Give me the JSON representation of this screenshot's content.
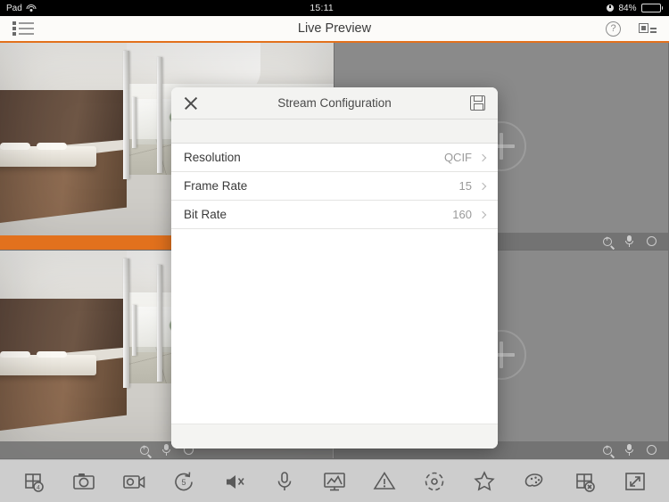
{
  "status_bar": {
    "carrier": "Pad",
    "wifi_icon": "wifi-icon",
    "time": "15:11",
    "lock_icon": "rotation-lock-icon",
    "battery_percent": "84%",
    "battery_level": 84
  },
  "nav_bar": {
    "menu_icon": "list-menu-icon",
    "title": "Live Preview",
    "help_icon": "help-circle-icon",
    "device_icon": "device-list-icon",
    "accent_color": "#e2711d"
  },
  "grid": {
    "tiles": [
      {
        "id": "tile-1",
        "state": "live",
        "selected": true,
        "overlay_icons": [
          "zoom-in-icon",
          "microphone-icon",
          "record-circle-icon"
        ]
      },
      {
        "id": "tile-2",
        "state": "empty",
        "selected": false,
        "add_label": "+"
      },
      {
        "id": "tile-3",
        "state": "live",
        "selected": false,
        "overlay_icons": [
          "zoom-in-icon",
          "microphone-icon",
          "record-circle-icon"
        ]
      },
      {
        "id": "tile-4",
        "state": "empty",
        "selected": false,
        "add_label": "+"
      }
    ]
  },
  "modal": {
    "title": "Stream Configuration",
    "close_icon": "close-icon",
    "save_icon": "save-floppy-icon",
    "rows": [
      {
        "label": "Resolution",
        "value": "QCIF"
      },
      {
        "label": "Frame Rate",
        "value": "15"
      },
      {
        "label": "Bit Rate",
        "value": "160"
      }
    ]
  },
  "toolbar": {
    "items": [
      {
        "name": "layout-grid-4-button",
        "icon": "grid-4-icon"
      },
      {
        "name": "snapshot-button",
        "icon": "camera-icon"
      },
      {
        "name": "record-button",
        "icon": "video-camera-icon"
      },
      {
        "name": "instant-playback-button",
        "icon": "rewind-5s-icon"
      },
      {
        "name": "audio-mute-button",
        "icon": "speaker-muted-icon"
      },
      {
        "name": "two-way-audio-button",
        "icon": "microphone-icon"
      },
      {
        "name": "picture-button",
        "icon": "picture-monitor-icon"
      },
      {
        "name": "alarm-button",
        "icon": "warning-triangle-icon"
      },
      {
        "name": "ptz-button",
        "icon": "ptz-circle-icon"
      },
      {
        "name": "favorite-button",
        "icon": "star-icon"
      },
      {
        "name": "image-settings-button",
        "icon": "palette-icon"
      },
      {
        "name": "close-all-button",
        "icon": "grid-close-icon"
      },
      {
        "name": "fullscreen-button",
        "icon": "expand-arrows-icon"
      }
    ]
  }
}
